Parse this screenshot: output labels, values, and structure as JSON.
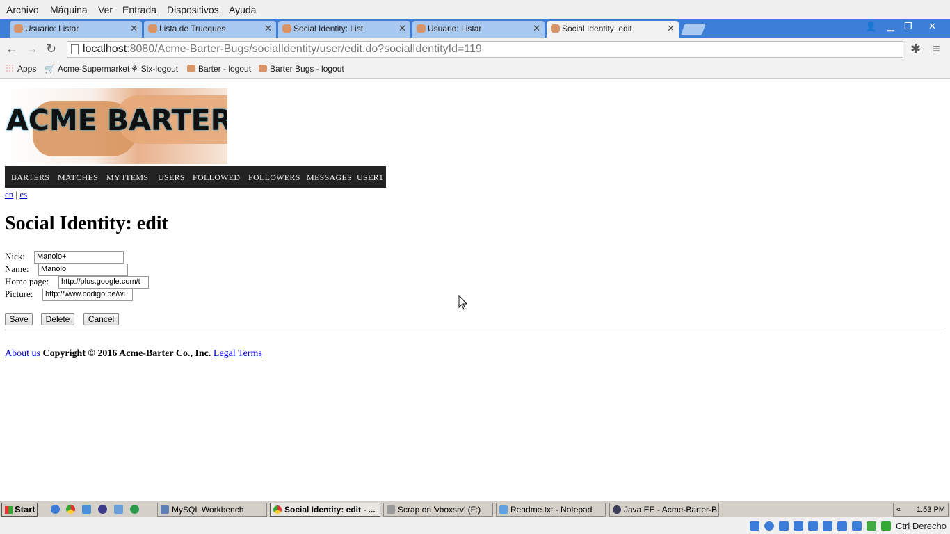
{
  "vbox_menu": [
    "Archivo",
    "Máquina",
    "Ver",
    "Entrada",
    "Dispositivos",
    "Ayuda"
  ],
  "tabs": [
    {
      "title": "Usuario: Listar"
    },
    {
      "title": "Lista de Trueques"
    },
    {
      "title": "Social Identity: List"
    },
    {
      "title": "Usuario: Listar"
    },
    {
      "title": "Social Identity: edit",
      "active": true
    }
  ],
  "address": {
    "host": "localhost",
    "rest": ":8080/Acme-Barter-Bugs/socialIdentity/user/edit.do?socialIdentityId=119"
  },
  "bookmarks": [
    "Apps",
    "Acme-Supermarket",
    "Six-logout",
    "Barter - logout",
    "Barter Bugs - logout"
  ],
  "banner_text": "ACME BARTER",
  "nav": [
    "BARTERS",
    "MATCHES",
    "MY ITEMS",
    "USERS",
    "FOLLOWED",
    "FOLLOWERS",
    "MESSAGES",
    "USER1"
  ],
  "lang": {
    "en": "en",
    "sep": "|",
    "es": "es"
  },
  "page_title": "Social Identity: edit",
  "form": {
    "nick": {
      "label": "Nick:",
      "value": "Manolo+"
    },
    "name": {
      "label": "Name:",
      "value": "Manolo"
    },
    "homepage": {
      "label": "Home page:",
      "value": "http://plus.google.com/t"
    },
    "picture": {
      "label": "Picture:",
      "value": "http://www.codigo.pe/wi"
    }
  },
  "buttons": {
    "save": "Save",
    "delete": "Delete",
    "cancel": "Cancel"
  },
  "footer": {
    "about": "About us",
    "copyright": "Copyright © 2016 Acme-Barter Co., Inc.",
    "legal": "Legal Terms"
  },
  "taskbar": {
    "start": "Start",
    "items": [
      "MySQL Workbench",
      "Social Identity: edit - ...",
      "Scrap on 'vboxsrv' (F:)",
      "Readme.txt - Notepad",
      "Java EE - Acme-Barter-B..."
    ],
    "clock": "1:53 PM",
    "arrows": "«"
  },
  "vbox_status": {
    "host_key": "Ctrl Derecho"
  },
  "colors": {
    "tabstrip": "#3d7fd8",
    "nav_bg": "#222222",
    "link": "#0000cc"
  }
}
